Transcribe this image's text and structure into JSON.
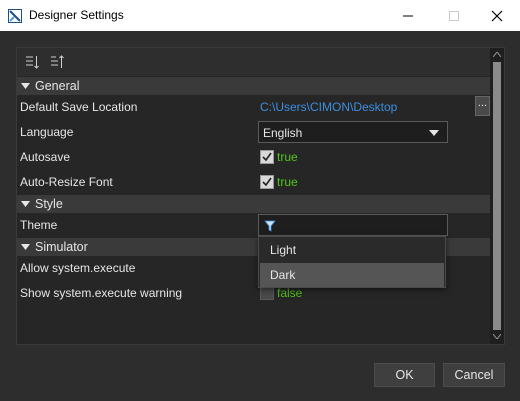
{
  "window": {
    "title": "Designer Settings",
    "app_icon": "designer-app-icon",
    "controls": [
      "minimize-icon",
      "maximize-icon",
      "close-icon"
    ]
  },
  "toolbar": {
    "buttons": [
      "categorized-sort-icon",
      "alphabetical-sort-icon"
    ]
  },
  "categories": [
    {
      "label": "General",
      "rows": [
        {
          "label": "Default Save Location",
          "value": "C:\\Users\\CIMON\\Desktop",
          "button": "..."
        },
        {
          "label": "Language",
          "value": "English"
        },
        {
          "label": "Autosave",
          "checked": true,
          "value": "true"
        },
        {
          "label": "Auto-Resize Font",
          "checked": true,
          "value": "true"
        }
      ]
    },
    {
      "label": "Style",
      "rows": [
        {
          "label": "Theme",
          "value": ""
        }
      ]
    },
    {
      "label": "Simulator",
      "rows": [
        {
          "label": "Allow system.execute"
        },
        {
          "label": "Show system.execute warning",
          "checked": false,
          "value": "false"
        }
      ]
    }
  ],
  "theme_dropdown": {
    "options": [
      "Light",
      "Dark"
    ],
    "highlighted": "Dark"
  },
  "footer": {
    "ok_label": "OK",
    "cancel_label": "Cancel"
  },
  "colors": {
    "link": "#3d8ee0",
    "true_value": "#52c41a",
    "background": "#2d2d2d",
    "category_header": "#3a3a3a"
  }
}
